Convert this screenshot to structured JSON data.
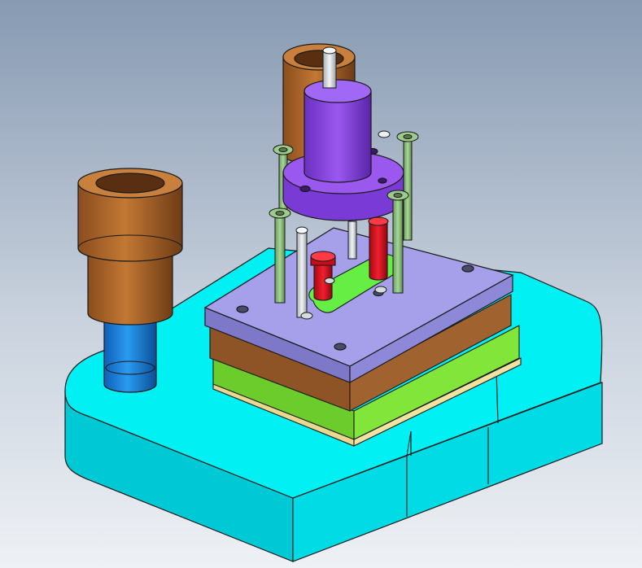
{
  "scene": {
    "subject": "stamping-die-assembly",
    "view": "isometric",
    "colors": {
      "background_top": "#879ab2",
      "background_bottom": "#eef1f5",
      "base_plate": "#00f0f4",
      "base_plate_side": "#00c9d6",
      "guide_bushing": "#b5682c",
      "guide_post": "#1f8ae6",
      "die_plate_brown": "#a0622e",
      "stripper_plate": "#9e98e6",
      "green_plate": "#82e63a",
      "spacer_cream": "#f0e2a0",
      "punch_holder": "#8a46e6",
      "bolts": "#8cc47c",
      "punches": "#e0101c",
      "pins": "#d8dce0",
      "outline": "#1a1a1a"
    },
    "components": [
      "base-plate",
      "guide-bushing-left",
      "guide-post-left",
      "guide-bushing-rear",
      "die-plate",
      "stripper-plate",
      "punch-holder-flange",
      "shank",
      "shoulder-bolts",
      "red-punches",
      "green-strip-part",
      "dowel-pins"
    ]
  }
}
